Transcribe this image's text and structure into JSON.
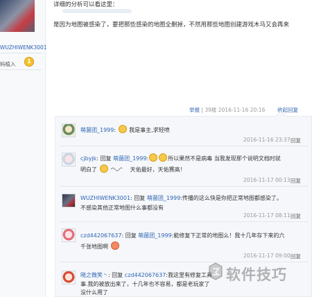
{
  "sidebar": {
    "username": "WUZHIWENK3001",
    "note": "码植入",
    "badge": "1"
  },
  "post": {
    "line1": "详细的分析可以看这里：",
    "line2": "是因为地图被感染了，要把那些感染的地图全删掉，不然用那些地图创建游戏木马又会再来"
  },
  "meta": {
    "report": "举报",
    "floor": "39楼",
    "datetime": "2016-11-16 20:16",
    "collapse": "收起回复"
  },
  "replies": [
    {
      "user": "萌菌团_1999",
      "text": "我是事主,求轻喷",
      "time": "2016-11-16 23:37",
      "reply": "回复"
    },
    {
      "user": "cjbyjk",
      "prefix": "回复",
      "target": "萌菌团_1999",
      "text1": "所以果然不是病毒 当我发现那个说明文档时就",
      "text2a": "明白了",
      "text2b": "天佑最好，天佑赛高！",
      "time": "2016-11-17 00:13",
      "reply": "回复"
    },
    {
      "user": "WUZHIWENK3001",
      "prefix": "回复",
      "target": "萌菌团_1999",
      "text1": "传播的这么快是你把正常地图都感染了。",
      "text2": "不感染其他正常地图什么事都没有",
      "time": "2016-11-17 08:11",
      "reply": "回复"
    },
    {
      "user": "czd442067637",
      "prefix": "回复",
      "target": "萌菌团_1999",
      "text1": "能修复下正常的地图么！我十几年存下来的六",
      "text2": "千张地图啊",
      "time": "2016-11-17 09:00",
      "reply": "回复"
    },
    {
      "user": "晓之微笑丶",
      "prefix": "回复",
      "target": "czd442067637",
      "text1": "我这里有修复工具",
      "text2": "事.我的被放出来了，十几年也不容易，都是老玩家了",
      "text3": "没什么用了"
    }
  ],
  "watermark": "软件技巧"
}
